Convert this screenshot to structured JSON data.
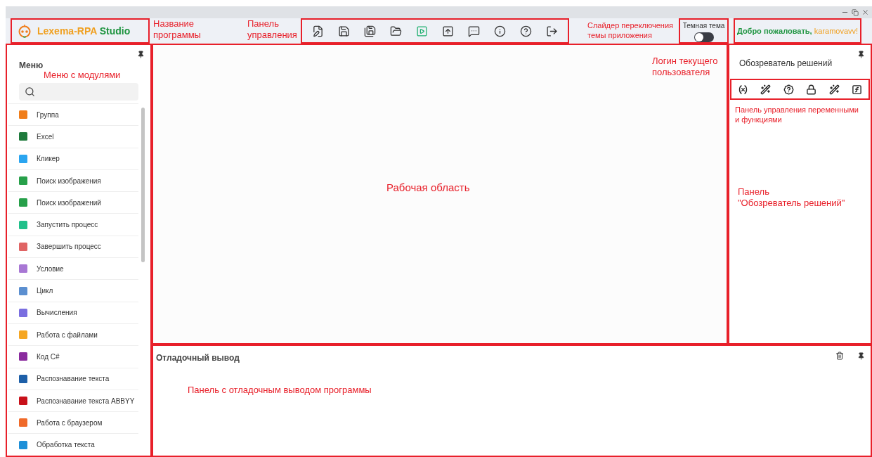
{
  "app": {
    "logo_main": "Lexema-RPA",
    "logo_accent": "Studio"
  },
  "theme_toggle": {
    "label": "Темная тема",
    "on": false
  },
  "welcome": {
    "greeting": "Добро пожаловать,",
    "user": "karamovavv!"
  },
  "menu": {
    "title": "Меню",
    "items": [
      {
        "label": "Группа"
      },
      {
        "label": "Excel"
      },
      {
        "label": "Кликер"
      },
      {
        "label": "Поиск изображения"
      },
      {
        "label": "Поиск изображений"
      },
      {
        "label": "Запустить процесс"
      },
      {
        "label": "Завершить процесс"
      },
      {
        "label": "Условие"
      },
      {
        "label": "Цикл"
      },
      {
        "label": "Вычисления"
      },
      {
        "label": "Работа с файлами"
      },
      {
        "label": "Код C#"
      },
      {
        "label": "Распознавание текста"
      },
      {
        "label": "Распознавание текста ABBYY"
      },
      {
        "label": "Работа с браузером"
      },
      {
        "label": "Обработка текста"
      }
    ]
  },
  "solution_explorer": {
    "title": "Обозреватель решений"
  },
  "debug_output": {
    "title": "Отладочный вывод"
  },
  "annotations": [
    {
      "lines": [
        "Название",
        "программы"
      ]
    },
    {
      "lines": [
        "Панель",
        "управления"
      ]
    },
    {
      "lines": [
        "Слайдер переключения",
        "темы приложения"
      ]
    },
    {
      "lines": [
        "Меню с модулями"
      ]
    },
    {
      "lines": [
        "Логин текущего",
        "пользователя"
      ]
    },
    {
      "lines": [
        "Рабочая область"
      ]
    },
    {
      "lines": [
        "Панель управления переменными",
        "и функциями"
      ]
    },
    {
      "lines": [
        "Панель",
        "\"Обозреватель решений\""
      ]
    },
    {
      "lines": [
        "Панель с отладочным выводом программы"
      ]
    }
  ]
}
